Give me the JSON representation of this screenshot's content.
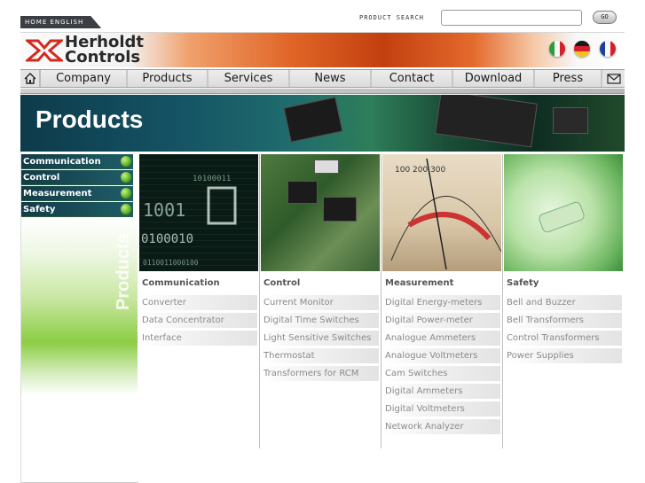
{
  "topbar": {
    "home_lang": "HOME ENGLISH",
    "search_label": "PRODUCT SEARCH",
    "search_value": "",
    "go_label": "GO"
  },
  "header": {
    "logo_line1": "Herholdt",
    "logo_line2": "Controls",
    "flags": [
      "flag-italy-icon",
      "flag-germany-icon",
      "flag-france-icon"
    ]
  },
  "nav": {
    "items": [
      "Company",
      "Products",
      "Services",
      "News",
      "Contact",
      "Download",
      "Press"
    ],
    "home_icon": "home-icon",
    "mail_icon": "mail-icon"
  },
  "banner": {
    "title": "Products"
  },
  "sidebar": {
    "items": [
      "Communication",
      "Control",
      "Measurement",
      "Safety"
    ],
    "vertical_label": "Products"
  },
  "columns": [
    {
      "title": "Communication",
      "items": [
        "Converter",
        "Data Concentrator",
        "Interface"
      ]
    },
    {
      "title": "Control",
      "items": [
        "Current Monitor",
        "Digital Time Switches",
        "Light Sensitive Switches",
        "Thermostat",
        "Transformers for RCM"
      ]
    },
    {
      "title": "Measurement",
      "items": [
        "Digital Energy-meters",
        "Digital Power-meter",
        "Analogue Ammeters",
        "Analogue Voltmeters",
        "Cam Switches",
        "Digital Ammeters",
        "Digital Voltmeters",
        "Network Analyzer"
      ]
    },
    {
      "title": "Safety",
      "items": [
        "Bell and Buzzer",
        "Bell Transformers",
        "Control Transformers",
        "Power Supplies"
      ]
    }
  ],
  "colors": {
    "accent_orange": "#e06426",
    "sidebar_teal": "#123b47",
    "dot_green": "#59b01d"
  }
}
